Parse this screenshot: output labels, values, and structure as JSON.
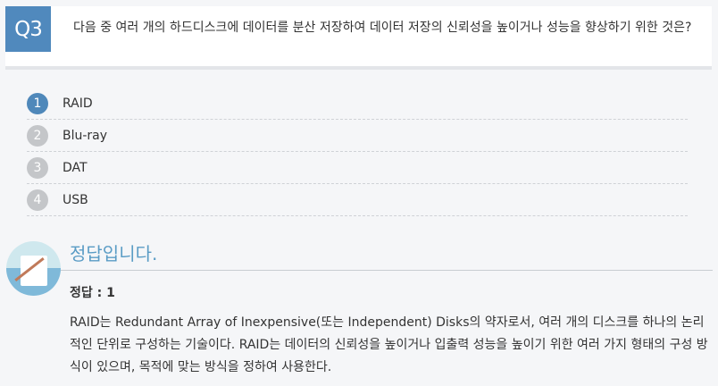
{
  "question": {
    "badge": "Q3",
    "text": "다음 중 여러 개의 하드디스크에 데이터를 분산 저장하여 데이터 저장의 신뢰성을 높이거나 성능을 향상하기 위한 것은?"
  },
  "options": [
    {
      "num": "1",
      "label": "RAID",
      "selected": true
    },
    {
      "num": "2",
      "label": "Blu-ray",
      "selected": false
    },
    {
      "num": "3",
      "label": "DAT",
      "selected": false
    },
    {
      "num": "4",
      "label": "USB",
      "selected": false
    }
  ],
  "answer": {
    "title": "정답입니다.",
    "label": "정답 : 1",
    "description": "RAID는 Redundant Array of Inexpensive(또는 Independent) Disks의 약자로서, 여러 개의 디스크를 하나의 논리적인 단위로 구성하는 기술이다. RAID는 데이터의 신뢰성을 높이거나 입출력 성능을 높이기 위한 여러 가지 형태의 구성 방식이 있으며, 목적에 맞는 방식을 정하여 사용한다."
  },
  "colors": {
    "accent": "#5089bd",
    "answer_title": "#5a9cc5",
    "inactive_num": "#c4c6c9"
  }
}
